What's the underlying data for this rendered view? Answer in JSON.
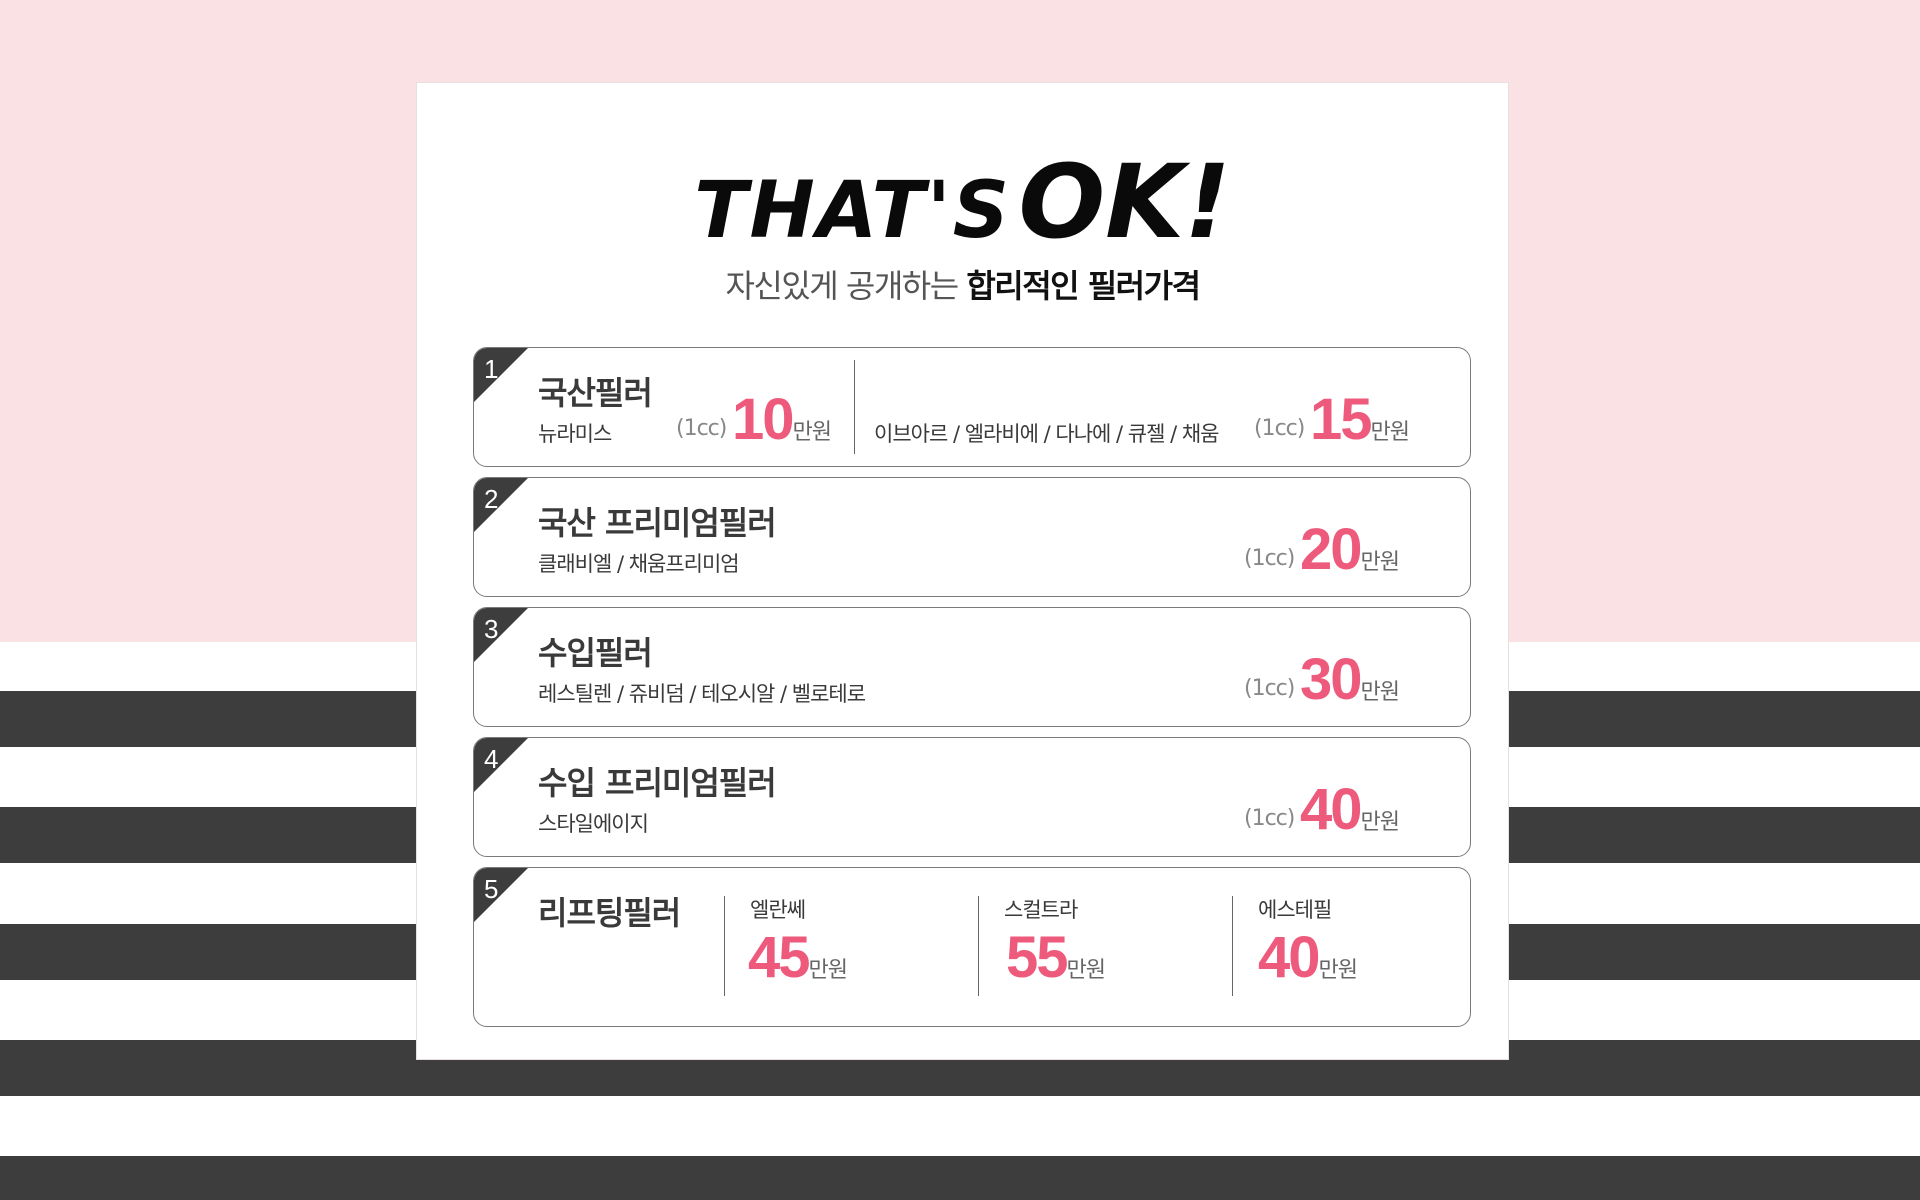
{
  "logo": {
    "part1": "THAT'S",
    "part2": "OK!"
  },
  "subtitle": {
    "normal": "자신있게 공개하는 ",
    "bold": "합리적인 필러가격"
  },
  "rows": [
    {
      "num": "1",
      "title": "국산필러",
      "left": {
        "brands": "뉴라미스",
        "cc": "(1cc)",
        "value": "10",
        "unit": "만원"
      },
      "right": {
        "brands": "이브아르 / 엘라비에 / 다나에 / 큐젤 / 채움",
        "cc": "(1cc)",
        "value": "15",
        "unit": "만원"
      }
    },
    {
      "num": "2",
      "title": "국산 프리미엄필러",
      "brands": "클래비엘 / 채움프리미엄",
      "cc": "(1cc)",
      "value": "20",
      "unit": "만원"
    },
    {
      "num": "3",
      "title": "수입필러",
      "brands": "레스틸렌 / 쥬비덤 / 테오시알 / 벨로테로",
      "cc": "(1cc)",
      "value": "30",
      "unit": "만원"
    },
    {
      "num": "4",
      "title": "수입 프리미엄필러",
      "brands": "스타일에이지",
      "cc": "(1cc)",
      "value": "40",
      "unit": "만원"
    },
    {
      "num": "5",
      "title": "리프팅필러",
      "options": [
        {
          "name": "엘란쎄",
          "value": "45",
          "unit": "만원"
        },
        {
          "name": "스컬트라",
          "value": "55",
          "unit": "만원"
        },
        {
          "name": "에스테필",
          "value": "40",
          "unit": "만원"
        }
      ]
    }
  ],
  "colors": {
    "accent": "#ee5a7c",
    "pink_bg": "#f9e1e4",
    "stripe": "#3d3d3d"
  }
}
